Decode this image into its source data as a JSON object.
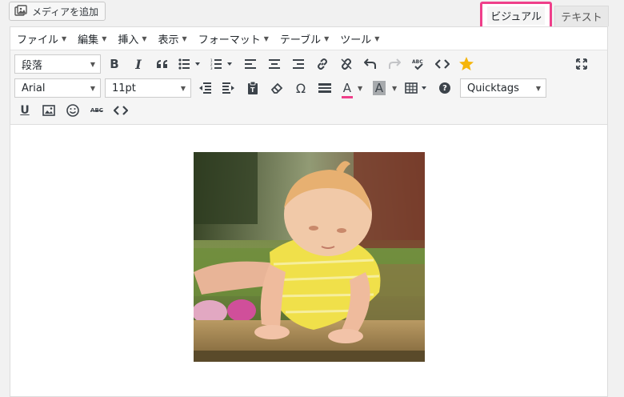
{
  "media_button": {
    "label": "メディアを追加",
    "icon": "media-icon"
  },
  "tabs": {
    "visual": "ビジュアル",
    "text": "テキスト"
  },
  "accent_color": "#ef3f8a",
  "menu": [
    "ファイル",
    "編集",
    "挿入",
    "表示",
    "フォーマット",
    "テーブル",
    "ツール"
  ],
  "toolbar": {
    "format_select": "段落",
    "font_select": "Arial",
    "size_select": "11pt",
    "quicktags_select": "Quicktags",
    "row1_icons": [
      "bold-icon",
      "italic-icon",
      "blockquote-icon",
      "bullet-list-icon",
      "numbered-list-icon",
      "align-left-icon",
      "align-center-icon",
      "align-right-icon",
      "link-icon",
      "unlink-icon",
      "undo-icon",
      "redo-icon",
      "spellcheck-icon",
      "code-icon",
      "star-icon",
      "fullscreen-icon"
    ],
    "row2_icons": [
      "outdent-icon",
      "indent-icon",
      "paste-icon",
      "eraser-icon",
      "omega-icon",
      "hr-icon",
      "text-color-icon",
      "bg-color-icon",
      "table-icon",
      "help-icon"
    ],
    "row3_icons": [
      "underline-icon",
      "image-icon",
      "emoji-icon",
      "strikethrough-icon",
      "code-icon"
    ],
    "bold_char": "B",
    "italic_char": "I",
    "omega_char": "Ω",
    "color_char": "A",
    "underline_char": "U",
    "abc_char": "ABC",
    "help_char": "?"
  },
  "content": {
    "image_alt": "baby-photo"
  }
}
